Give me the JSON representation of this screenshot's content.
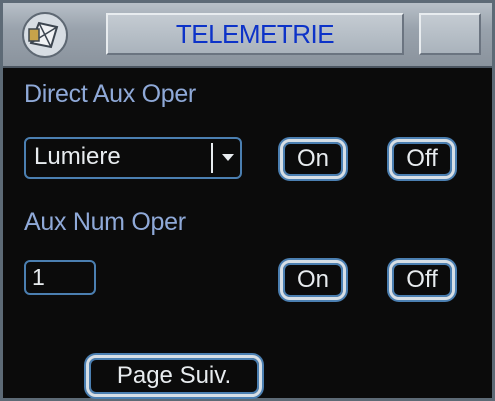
{
  "window": {
    "title": "TELEMETRIE",
    "icon": "camera-icon"
  },
  "direct_aux": {
    "label": "Direct Aux Oper",
    "select_value": "Lumiere",
    "on_label": "On",
    "off_label": "Off"
  },
  "aux_num": {
    "label": "Aux Num Oper",
    "input_value": "1",
    "on_label": "On",
    "off_label": "Off"
  },
  "footer": {
    "next_page_label": "Page Suiv."
  },
  "colors": {
    "title_text": "#0d33c8",
    "label_text": "#8fa9d8",
    "button_border": "#4b7fb1",
    "background": "#0b0b0b"
  }
}
